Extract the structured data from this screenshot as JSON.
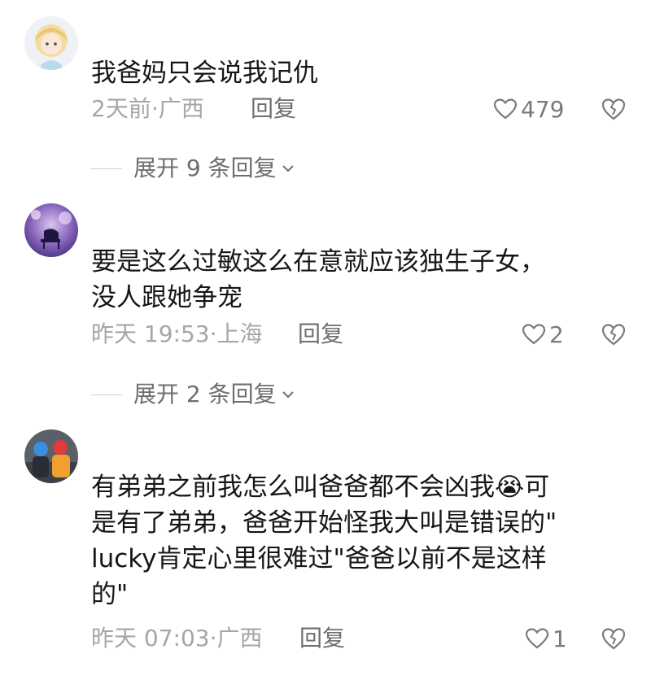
{
  "comments": [
    {
      "text": "我爸妈只会说我记仇",
      "meta": "2天前·广西",
      "reply_label": "回复",
      "likes": "479",
      "expand_label": "展开 9 条回复"
    },
    {
      "text": "要是这么过敏这么在意就应该独生子女，\n没人跟她争宠",
      "meta": "昨天 19:53·上海",
      "reply_label": "回复",
      "likes": "2",
      "expand_label": "展开 2 条回复"
    },
    {
      "text": "有弟弟之前我怎么叫爸爸都不会凶我😭可\n是有了弟弟，爸爸开始怪我大叫是错误的\"\nlucky肯定心里很难过\"爸爸以前不是这样\n的\"",
      "meta": "昨天 07:03·广西",
      "reply_label": "回复",
      "likes": "1"
    }
  ],
  "colors": {
    "text": "#161616",
    "meta": "#a6a6a6",
    "action": "#6e6e6e",
    "icon": "#7a7a7a"
  },
  "icons": [
    "heart-outline-icon",
    "broken-heart-icon",
    "chevron-down-icon"
  ]
}
